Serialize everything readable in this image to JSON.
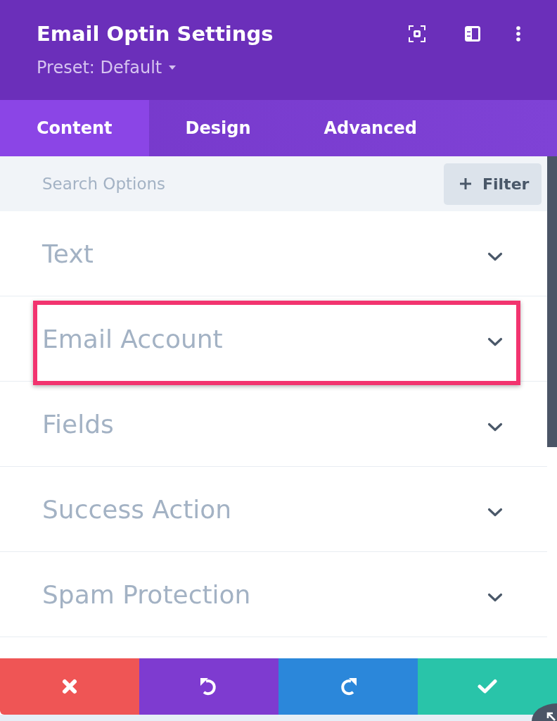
{
  "header": {
    "title": "Email Optin Settings",
    "preset": "Preset: Default"
  },
  "tabs": [
    {
      "label": "Content",
      "selected": true
    },
    {
      "label": "Design",
      "selected": false
    },
    {
      "label": "Advanced",
      "selected": false
    }
  ],
  "search": {
    "placeholder": "Search Options",
    "filter_button": "Filter"
  },
  "sections": [
    {
      "label": "Text",
      "highlighted": false
    },
    {
      "label": "Email Account",
      "highlighted": true
    },
    {
      "label": "Fields",
      "highlighted": false
    },
    {
      "label": "Success Action",
      "highlighted": false
    },
    {
      "label": "Spam Protection",
      "highlighted": false
    }
  ],
  "actions": [
    {
      "kind": "cancel"
    },
    {
      "kind": "undo"
    },
    {
      "kind": "redo"
    },
    {
      "kind": "save"
    }
  ]
}
